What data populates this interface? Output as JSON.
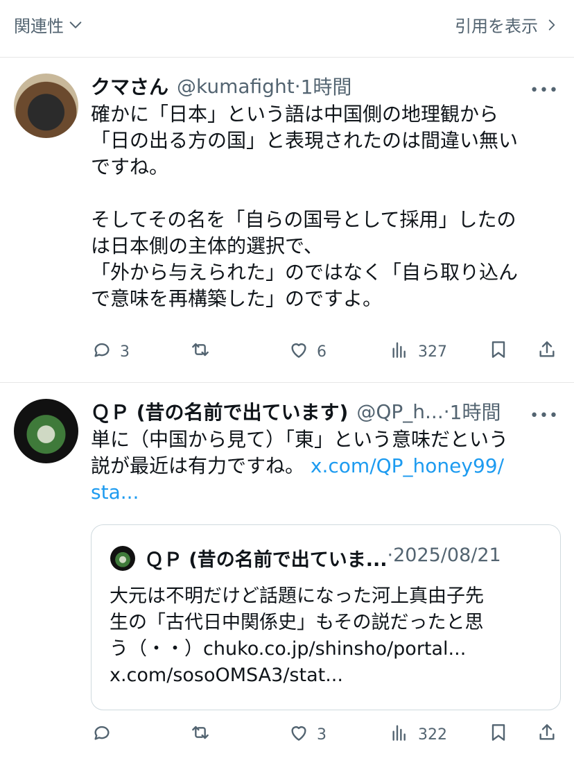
{
  "topbar": {
    "filter_label": "関連性",
    "show_quotes_label": "引用を表示"
  },
  "tweets": [
    {
      "name": "クマさん",
      "handle": "@kumafight",
      "dot": "·",
      "time": "1時間",
      "text": "確かに「日本」という語は中国側の地理観から\n「日の出る方の国」と表現されたのは間違い無い\nですね。\n\nそしてその名を「自らの国号として採用」したの\nは日本側の主体的選択で、\n「外から与えられた」のではなく「自ら取り込ん\nで意味を再構築した」のですよ。",
      "replies": "3",
      "retweets": "",
      "likes": "6",
      "views": "327"
    },
    {
      "name": "ＱＰ (昔の名前で出ています)",
      "handle": "@QP_h...",
      "dot": "·",
      "time": "1時間",
      "text": "単に（中国から見て）「東」という意味だという\n説が最近は有力ですね。",
      "link": "x.com/QP_honey99/\nsta...",
      "replies": "",
      "retweets": "",
      "likes": "3",
      "views": "322"
    }
  ],
  "quote": {
    "name": "ＱＰ (昔の名前で出ていま...",
    "date": "·2025/08/21",
    "text": "大元は不明だけど話題になった河上真由子先\n生の「古代日中関係史」もその説だったと思\nう（・・）chuko.co.jp/shinsho/portal...\nx.com/sosoOMSA3/stat..."
  },
  "colors": {
    "accent": "#1d9bf0",
    "muted": "#536471",
    "border": "#cfd9de"
  },
  "icons": [
    "chevron-down-icon",
    "chevron-right-icon",
    "more-icon",
    "reply-icon",
    "retweet-icon",
    "like-icon",
    "views-icon",
    "bookmark-icon",
    "share-icon"
  ]
}
